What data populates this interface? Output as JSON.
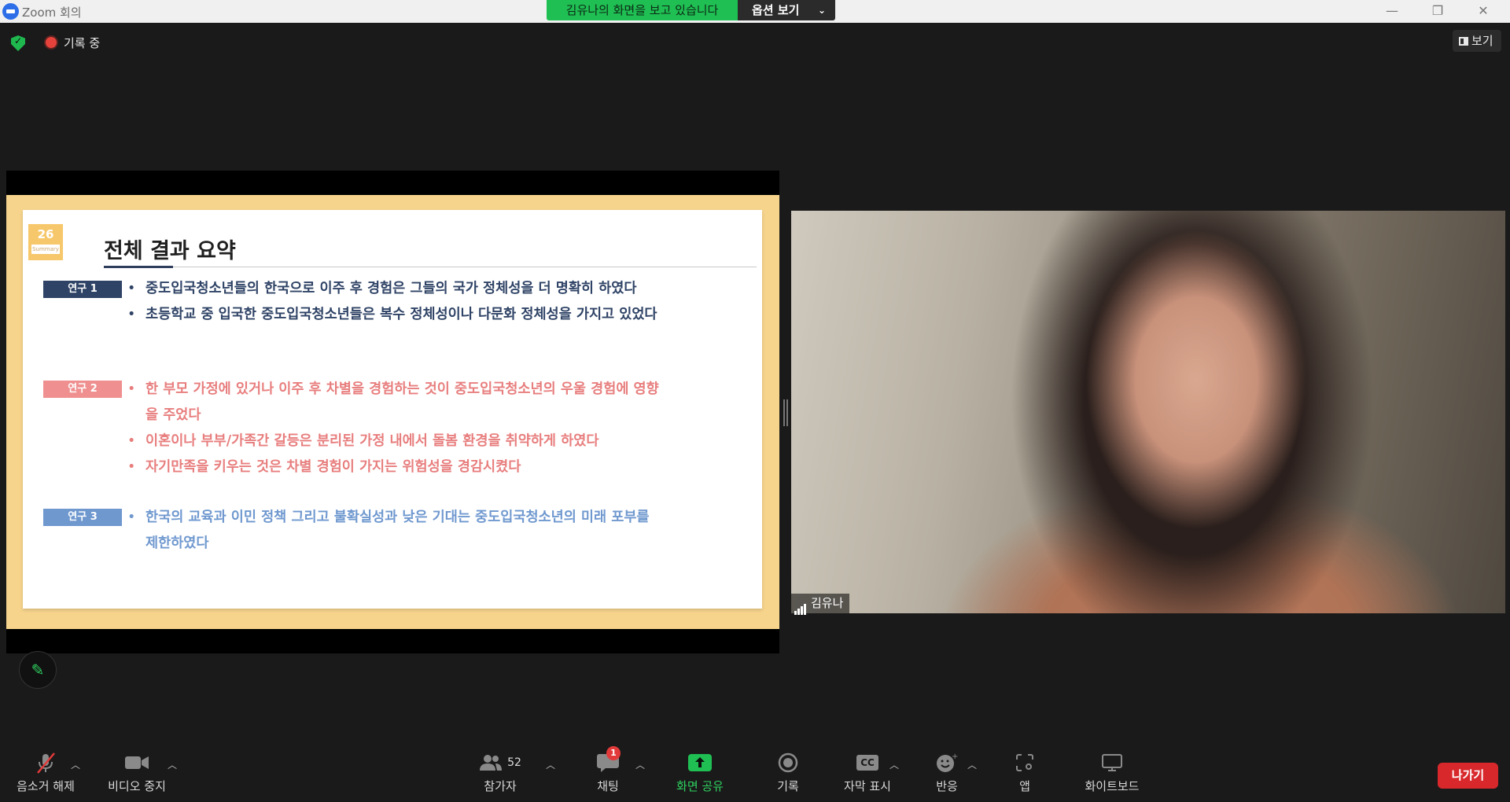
{
  "window": {
    "title": "Zoom 회의",
    "share_banner": "김유나의 화면을 보고 있습니다",
    "options_label": "옵션 보기",
    "controls": [
      "minimize",
      "restore",
      "close"
    ]
  },
  "top_bar": {
    "recording_label": "기록 중",
    "view_label": "보기"
  },
  "slide": {
    "page_number": "26",
    "page_sub": "Summary",
    "title": "전체 결과 요약",
    "studies": [
      {
        "tag": "연구 1",
        "bullets": [
          "중도입국청소년들의 한국으로 이주 후 경험은 그들의 국가 정체성을 더 명확히 하였다",
          "초등학교 중 입국한 중도입국청소년들은 복수 정체성이나 다문화 정체성을 가지고 있었다"
        ]
      },
      {
        "tag": "연구 2",
        "bullets": [
          "한 부모 가정에 있거나 이주 후 차별을 경험하는 것이 중도입국청소년의 우울 경험에 영향",
          "을 주었다",
          "이혼이나 부부/가족간 갈등은 분리된 가정 내에서 돌봄 환경을 취약하게 하였다",
          "자기만족을 키우는 것은 차별 경험이 가지는 위험성을 경감시켰다"
        ]
      },
      {
        "tag": "연구 3",
        "bullets": [
          "한국의 교육과 이민 정책 그리고 불확실성과 낮은 기대는 중도입국청소년의 미래 포부를",
          "제한하였다"
        ]
      }
    ]
  },
  "video": {
    "participant_name": "김유나"
  },
  "toolbar": {
    "mute": "음소거 해제",
    "video": "비디오 중지",
    "participants": "참가자",
    "participants_count": "52",
    "chat": "채팅",
    "chat_badge": "1",
    "share_screen": "화면 공유",
    "record": "기록",
    "captions": "자막 표시",
    "captions_icon": "CC",
    "reactions": "반응",
    "apps": "앱",
    "whiteboard": "화이트보드",
    "leave": "나가기"
  },
  "colors": {
    "share_green": "#1fbf53",
    "leave_red": "#d8282c",
    "study1": "#2f4366",
    "study2": "#e87e7e",
    "study3": "#6f98cf",
    "slide_frame": "#f6d48c"
  }
}
